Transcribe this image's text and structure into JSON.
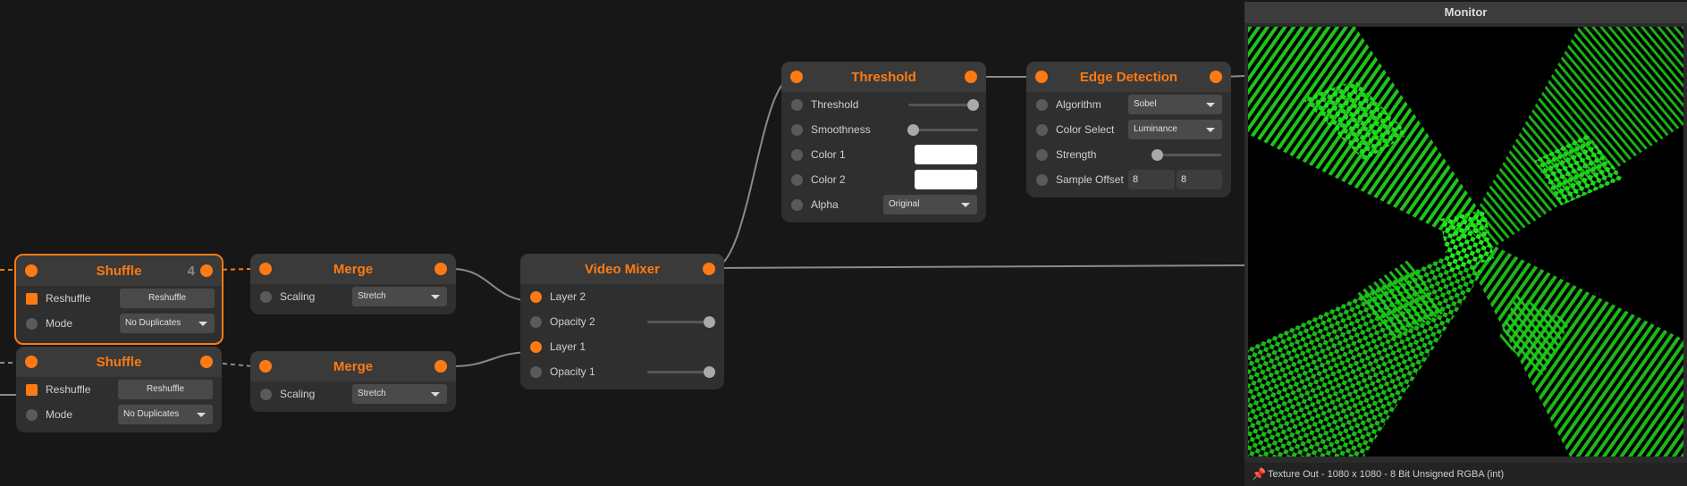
{
  "colors": {
    "accent": "#ff7a12",
    "background": "#171717",
    "node": "#2f2f2f",
    "preview_green": "#22e61e"
  },
  "nodes": {
    "shuffle1": {
      "title": "Shuffle",
      "badge": "4",
      "reshuffle_label": "Reshuffle",
      "reshuffle_button": "Reshuffle",
      "mode_label": "Mode",
      "mode_value": "No Duplicates"
    },
    "shuffle2": {
      "title": "Shuffle",
      "reshuffle_label": "Reshuffle",
      "reshuffle_button": "Reshuffle",
      "mode_label": "Mode",
      "mode_value": "No Duplicates"
    },
    "merge1": {
      "title": "Merge",
      "scaling_label": "Scaling",
      "scaling_value": "Stretch"
    },
    "merge2": {
      "title": "Merge",
      "scaling_label": "Scaling",
      "scaling_value": "Stretch"
    },
    "video_mixer": {
      "title": "Video Mixer",
      "layer2": "Layer 2",
      "opacity2": "Opacity 2",
      "layer1": "Layer 1",
      "opacity1": "Opacity 1",
      "opacity2_value": 1.0,
      "opacity1_value": 1.0
    },
    "threshold": {
      "title": "Threshold",
      "threshold_label": "Threshold",
      "smoothness_label": "Smoothness",
      "color1_label": "Color 1",
      "color2_label": "Color 2",
      "alpha_label": "Alpha",
      "alpha_value": "Original",
      "threshold_value": 1.0,
      "smoothness_value": 0.0,
      "color1": "#ffffff",
      "color2": "#ffffff"
    },
    "edge_detection": {
      "title": "Edge Detection",
      "algorithm_label": "Algorithm",
      "algorithm_value": "Sobel",
      "color_select_label": "Color Select",
      "color_select_value": "Luminance",
      "strength_label": "Strength",
      "strength_value": 0.0,
      "sample_offset_label": "Sample Offset",
      "sample_offset_x": "8",
      "sample_offset_y": "8"
    }
  },
  "monitor": {
    "title": "Monitor",
    "status": "Texture Out - 1080 x 1080 - 8 Bit Unsigned RGBA (int)",
    "pin_icon": "pin-icon"
  }
}
